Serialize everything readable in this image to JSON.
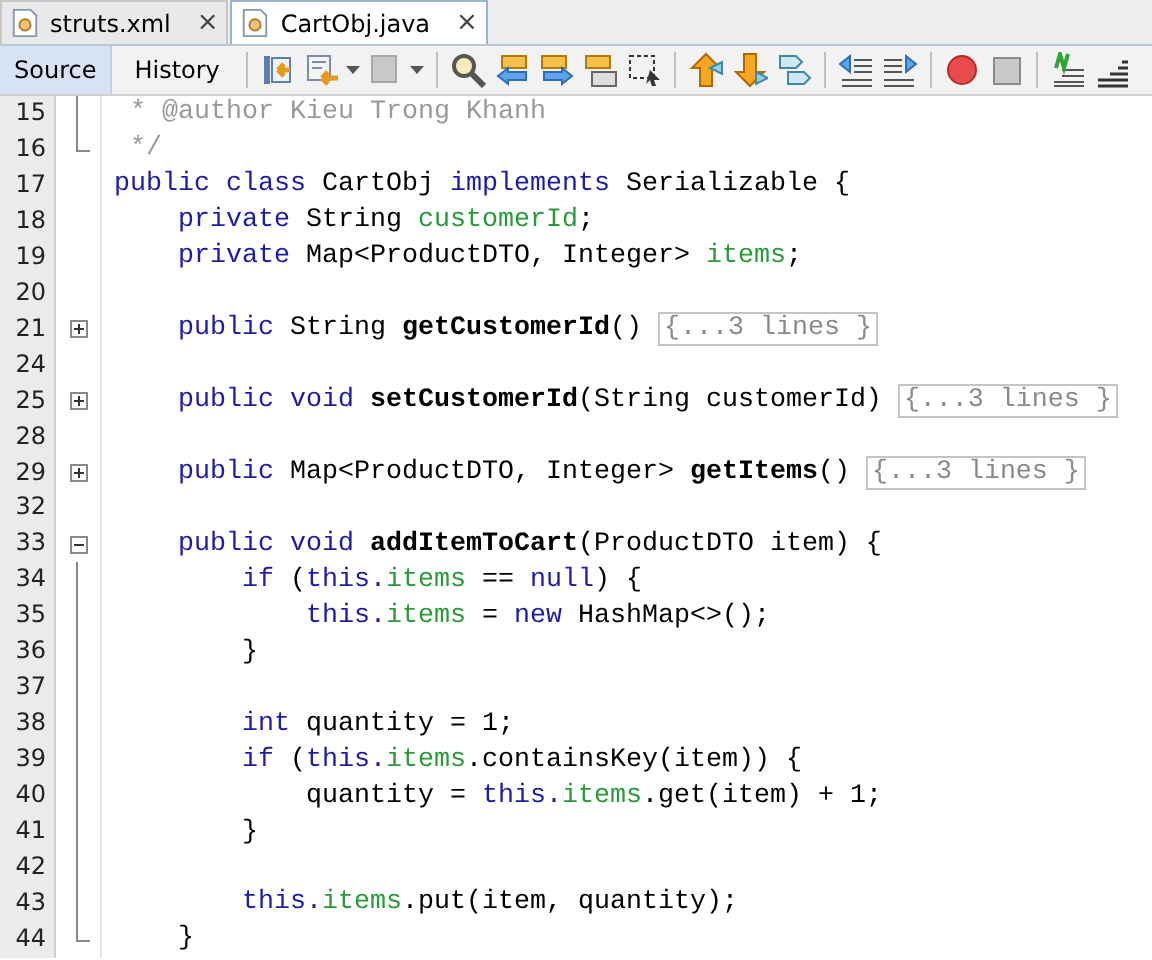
{
  "file_tabs": [
    {
      "label": "struts.xml",
      "selected": false,
      "close": "×"
    },
    {
      "label": "CartObj.java",
      "selected": true,
      "close": "×"
    }
  ],
  "view_tabs": [
    {
      "label": "Source",
      "selected": true
    },
    {
      "label": "History",
      "selected": false
    }
  ],
  "editor": {
    "lines": [
      {
        "number": "15",
        "kind": "guide",
        "tokens": [
          {
            "kind": "comment",
            "t": " * @author Kieu Trong Khanh"
          }
        ]
      },
      {
        "number": "16",
        "kind": "end",
        "tokens": [
          {
            "kind": "comment",
            "t": " */"
          }
        ]
      },
      {
        "number": "17",
        "kind": "plain",
        "tokens": [
          {
            "kind": "keyword",
            "t": "public class "
          },
          {
            "kind": "plain",
            "t": "CartObj "
          },
          {
            "kind": "keyword",
            "t": "implements "
          },
          {
            "kind": "plain",
            "t": "Serializable {"
          }
        ]
      },
      {
        "number": "18",
        "kind": "plain",
        "tokens": [
          {
            "kind": "keyword",
            "t": "    private "
          },
          {
            "kind": "plain",
            "t": "String "
          },
          {
            "kind": "field",
            "t": "customerId"
          },
          {
            "kind": "plain",
            "t": ";"
          }
        ]
      },
      {
        "number": "19",
        "kind": "plain",
        "tokens": [
          {
            "kind": "keyword",
            "t": "    private "
          },
          {
            "kind": "plain",
            "t": "Map<ProductDTO, Integer> "
          },
          {
            "kind": "field",
            "t": "items"
          },
          {
            "kind": "plain",
            "t": ";"
          }
        ]
      },
      {
        "number": "20",
        "kind": "plain"
      },
      {
        "number": "21",
        "kind": "collapsed",
        "tokens": [
          {
            "kind": "keyword",
            "t": "    public "
          },
          {
            "kind": "plain",
            "t": "String "
          },
          {
            "kind": "method",
            "t": "getCustomerId"
          },
          {
            "kind": "plain",
            "t": "() "
          }
        ],
        "folded": "{...3 lines }"
      },
      {
        "number": "24",
        "kind": "plain"
      },
      {
        "number": "25",
        "kind": "collapsed",
        "tokens": [
          {
            "kind": "keyword",
            "t": "    public void "
          },
          {
            "kind": "method",
            "t": "setCustomerId"
          },
          {
            "kind": "plain",
            "t": "(String customerId) "
          }
        ],
        "folded": "{...3 lines }"
      },
      {
        "number": "28",
        "kind": "plain"
      },
      {
        "number": "29",
        "kind": "collapsed",
        "tokens": [
          {
            "kind": "keyword",
            "t": "    public "
          },
          {
            "kind": "plain",
            "t": "Map<ProductDTO, Integer> "
          },
          {
            "kind": "method",
            "t": "getItems"
          },
          {
            "kind": "plain",
            "t": "() "
          }
        ],
        "folded": "{...3 lines }"
      },
      {
        "number": "32",
        "kind": "plain"
      },
      {
        "number": "33",
        "kind": "expanded",
        "tokens": [
          {
            "kind": "keyword",
            "t": "    public void "
          },
          {
            "kind": "method",
            "t": "addItemToCart"
          },
          {
            "kind": "plain",
            "t": "(ProductDTO item) {"
          }
        ]
      },
      {
        "number": "34",
        "kind": "guide",
        "tokens": [
          {
            "kind": "keyword",
            "t": "        if "
          },
          {
            "kind": "plain",
            "t": "("
          },
          {
            "kind": "keyword",
            "t": "this."
          },
          {
            "kind": "field",
            "t": "items"
          },
          {
            "kind": "plain",
            "t": " == "
          },
          {
            "kind": "keyword",
            "t": "null"
          },
          {
            "kind": "plain",
            "t": ") {"
          }
        ]
      },
      {
        "number": "35",
        "kind": "guide",
        "tokens": [
          {
            "kind": "keyword",
            "t": "            this."
          },
          {
            "kind": "field",
            "t": "items"
          },
          {
            "kind": "plain",
            "t": " = "
          },
          {
            "kind": "keyword",
            "t": "new "
          },
          {
            "kind": "plain",
            "t": "HashMap<>();"
          }
        ]
      },
      {
        "number": "36",
        "kind": "guide",
        "tokens": [
          {
            "kind": "plain",
            "t": "        }"
          }
        ]
      },
      {
        "number": "37",
        "kind": "guide"
      },
      {
        "number": "38",
        "kind": "guide",
        "tokens": [
          {
            "kind": "keyword",
            "t": "        int "
          },
          {
            "kind": "plain",
            "t": "quantity = 1;"
          }
        ]
      },
      {
        "number": "39",
        "kind": "guide",
        "tokens": [
          {
            "kind": "keyword",
            "t": "        if "
          },
          {
            "kind": "plain",
            "t": "("
          },
          {
            "kind": "keyword",
            "t": "this."
          },
          {
            "kind": "field",
            "t": "items"
          },
          {
            "kind": "plain",
            "t": ".containsKey(item)) {"
          }
        ]
      },
      {
        "number": "40",
        "kind": "guide",
        "tokens": [
          {
            "kind": "plain",
            "t": "            quantity = "
          },
          {
            "kind": "keyword",
            "t": "this."
          },
          {
            "kind": "field",
            "t": "items"
          },
          {
            "kind": "plain",
            "t": ".get(item) + 1;"
          }
        ]
      },
      {
        "number": "41",
        "kind": "guide",
        "tokens": [
          {
            "kind": "plain",
            "t": "        }"
          }
        ]
      },
      {
        "number": "42",
        "kind": "guide"
      },
      {
        "number": "43",
        "kind": "guide",
        "tokens": [
          {
            "kind": "keyword",
            "t": "        this."
          },
          {
            "kind": "field",
            "t": "items"
          },
          {
            "kind": "plain",
            "t": ".put(item, quantity);"
          }
        ]
      },
      {
        "number": "44",
        "kind": "end",
        "tokens": [
          {
            "kind": "plain",
            "t": "    }"
          }
        ]
      }
    ]
  }
}
